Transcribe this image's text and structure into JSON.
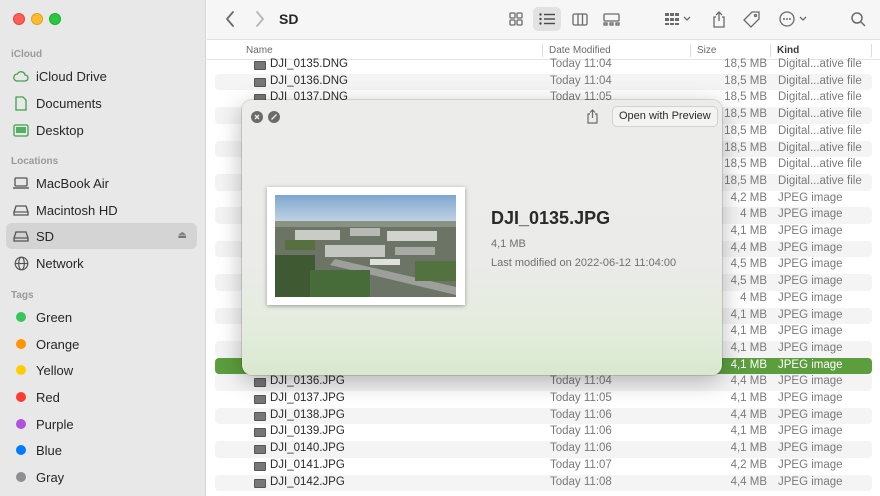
{
  "window": {
    "title": "SD"
  },
  "sidebar": {
    "sections": [
      {
        "title": "iCloud",
        "items": [
          {
            "label": "iCloud Drive",
            "icon": "cloud-icon"
          },
          {
            "label": "Documents",
            "icon": "document-icon"
          },
          {
            "label": "Desktop",
            "icon": "desktop-icon"
          }
        ]
      },
      {
        "title": "Locations",
        "items": [
          {
            "label": "MacBook Air",
            "icon": "laptop-icon"
          },
          {
            "label": "Macintosh HD",
            "icon": "disk-icon"
          },
          {
            "label": "SD",
            "icon": "disk-icon",
            "selected": true,
            "eject": "⏏"
          },
          {
            "label": "Network",
            "icon": "globe-icon"
          }
        ]
      },
      {
        "title": "Tags",
        "items": [
          {
            "label": "Green",
            "color": "#34c759"
          },
          {
            "label": "Orange",
            "color": "#ff9500"
          },
          {
            "label": "Yellow",
            "color": "#ffcc00"
          },
          {
            "label": "Red",
            "color": "#ff3b30"
          },
          {
            "label": "Purple",
            "color": "#af52de"
          },
          {
            "label": "Blue",
            "color": "#007aff"
          },
          {
            "label": "Gray",
            "color": "#8e8e93"
          }
        ]
      }
    ]
  },
  "list": {
    "columns": {
      "name": "Name",
      "date": "Date Modified",
      "size": "Size",
      "kind": "Kind"
    },
    "rows": [
      {
        "name": "DJI_0135.DNG",
        "date": "Today 11:04",
        "size": "18,5 MB",
        "kind": "Digital...ative file"
      },
      {
        "name": "DJI_0136.DNG",
        "date": "Today 11:04",
        "size": "18,5 MB",
        "kind": "Digital...ative file"
      },
      {
        "name": "DJI_0137.DNG",
        "date": "Today 11:05",
        "size": "18,5 MB",
        "kind": "Digital...ative file"
      },
      {
        "name": "",
        "date": "",
        "size": "18,5 MB",
        "kind": "Digital...ative file"
      },
      {
        "name": "",
        "date": "",
        "size": "18,5 MB",
        "kind": "Digital...ative file"
      },
      {
        "name": "",
        "date": "",
        "size": "18,5 MB",
        "kind": "Digital...ative file"
      },
      {
        "name": "",
        "date": "",
        "size": "18,5 MB",
        "kind": "Digital...ative file"
      },
      {
        "name": "",
        "date": "",
        "size": "18,5 MB",
        "kind": "Digital...ative file"
      },
      {
        "name": "",
        "date": "",
        "size": "4,2 MB",
        "kind": "JPEG image"
      },
      {
        "name": "",
        "date": "",
        "size": "4 MB",
        "kind": "JPEG image"
      },
      {
        "name": "",
        "date": "",
        "size": "4,1 MB",
        "kind": "JPEG image"
      },
      {
        "name": "",
        "date": "",
        "size": "4,4 MB",
        "kind": "JPEG image"
      },
      {
        "name": "",
        "date": "",
        "size": "4,5 MB",
        "kind": "JPEG image"
      },
      {
        "name": "",
        "date": "",
        "size": "4,5 MB",
        "kind": "JPEG image"
      },
      {
        "name": "",
        "date": "",
        "size": "4 MB",
        "kind": "JPEG image"
      },
      {
        "name": "",
        "date": "",
        "size": "4,1 MB",
        "kind": "JPEG image"
      },
      {
        "name": "",
        "date": "",
        "size": "4,1 MB",
        "kind": "JPEG image"
      },
      {
        "name": "",
        "date": "",
        "size": "4,1 MB",
        "kind": "JPEG image"
      },
      {
        "name": "",
        "date": "",
        "size": "4,1 MB",
        "kind": "JPEG image",
        "selected": true
      },
      {
        "name": "DJI_0136.JPG",
        "date": "Today 11:04",
        "size": "4,4 MB",
        "kind": "JPEG image"
      },
      {
        "name": "DJI_0137.JPG",
        "date": "Today 11:05",
        "size": "4,1 MB",
        "kind": "JPEG image"
      },
      {
        "name": "DJI_0138.JPG",
        "date": "Today 11:06",
        "size": "4,4 MB",
        "kind": "JPEG image"
      },
      {
        "name": "DJI_0139.JPG",
        "date": "Today 11:06",
        "size": "4,1 MB",
        "kind": "JPEG image"
      },
      {
        "name": "DJI_0140.JPG",
        "date": "Today 11:06",
        "size": "4,1 MB",
        "kind": "JPEG image"
      },
      {
        "name": "DJI_0141.JPG",
        "date": "Today 11:07",
        "size": "4,2 MB",
        "kind": "JPEG image"
      },
      {
        "name": "DJI_0142.JPG",
        "date": "Today 11:08",
        "size": "4,4 MB",
        "kind": "JPEG image"
      }
    ]
  },
  "quicklook": {
    "open_with": "Open with Preview",
    "file_name": "DJI_0135.JPG",
    "file_size": "4,1 MB",
    "modified": "Last modified on 2022-06-12 11:04:00"
  },
  "colors": {
    "selection": "#5c9e3e",
    "sidebar_bg": "#e8e8e8"
  }
}
